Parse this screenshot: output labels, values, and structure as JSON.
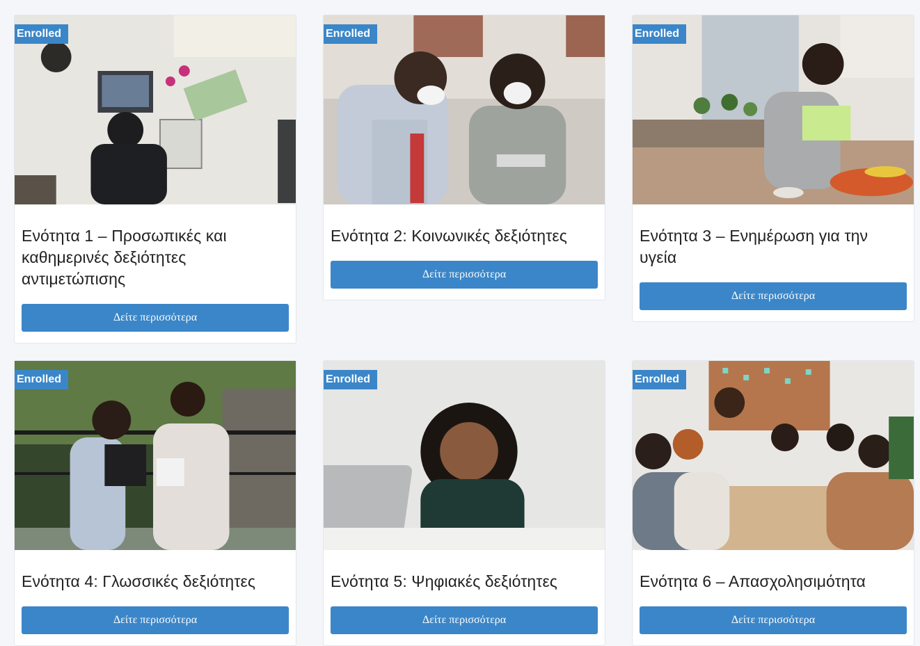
{
  "colors": {
    "accent": "#3b86c8",
    "page_bg": "#f4f6f9"
  },
  "cards": [
    {
      "badge": "Enrolled",
      "title": "Ενότητα 1 – Προσωπικές και καθημερινές δεξιότητες αντιμετώπισης",
      "button": "Δείτε περισσότερα"
    },
    {
      "badge": "Enrolled",
      "title": "Ενότητα 2: Κοινωνικές δεξιότητες",
      "button": "Δείτε περισσότερα"
    },
    {
      "badge": "Enrolled",
      "title": "Ενότητα 3 – Ενημέρωση για την υγεία",
      "button": "Δείτε περισσότερα"
    },
    {
      "badge": "Enrolled",
      "title": "Ενότητα 4: Γλωσσικές δεξιότητες",
      "button": "Δείτε περισσότερα"
    },
    {
      "badge": "Enrolled",
      "title": "Ενότητα 5: Ψηφιακές δεξιότητες",
      "button": "Δείτε περισσότερα"
    },
    {
      "badge": "Enrolled",
      "title": "Ενότητα 6 – Απασχολησιμότητα",
      "button": "Δείτε περισσότερα"
    }
  ]
}
